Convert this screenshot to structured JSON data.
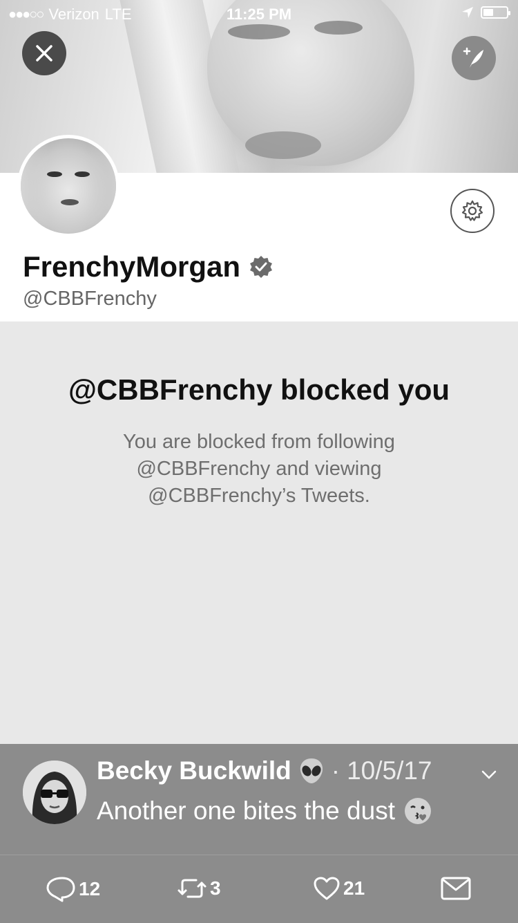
{
  "status_bar": {
    "carrier": "Verizon",
    "network": "LTE",
    "time": "11:25 PM"
  },
  "profile": {
    "display_name": "FrenchyMorgan",
    "handle": "@CBBFrenchy",
    "verified": true
  },
  "blocked": {
    "title": "@CBBFrenchy blocked you",
    "line1": "You are blocked from following",
    "line2": "@CBBFrenchy and viewing",
    "line3": "@CBBFrenchy’s Tweets."
  },
  "tweet": {
    "author": "Becky Buckwild",
    "separator": "·",
    "date": "10/5/17",
    "text": "Another one bites the dust",
    "replies": "12",
    "retweets": "3",
    "likes": "21"
  },
  "icons": [
    "close-icon",
    "compose-icon",
    "gear-icon",
    "verified-icon",
    "alien-emoji-icon",
    "chevron-down-icon",
    "kiss-emoji-icon",
    "reply-icon",
    "retweet-icon",
    "like-icon",
    "message-icon",
    "location-arrow-icon",
    "battery-icon",
    "signal-dots-icon"
  ],
  "colors": {
    "overlay_gray": "#8c8c8c",
    "background": "#e8e8e8"
  }
}
